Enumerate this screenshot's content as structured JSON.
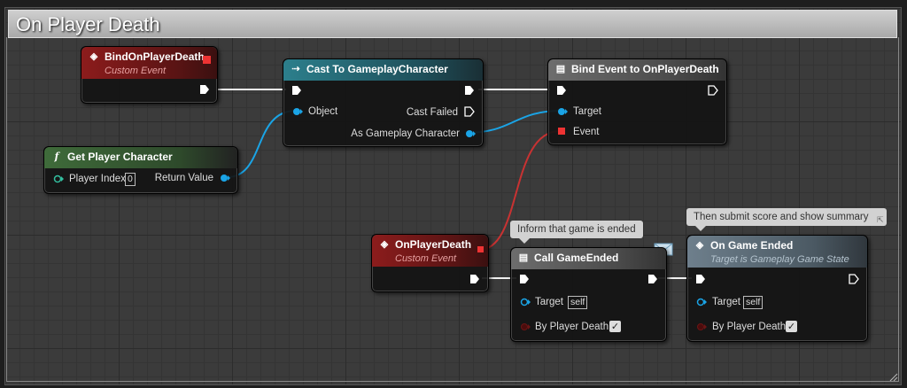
{
  "comment": {
    "title": "On Player Death"
  },
  "nodes": {
    "bind_on_player_death": {
      "title": "BindOnPlayerDeath",
      "subtitle": "Custom Event"
    },
    "cast_to_gameplay_character": {
      "title": "Cast To GameplayCharacter",
      "pins": {
        "object": "Object",
        "cast_failed": "Cast Failed",
        "as_gameplay_character": "As Gameplay Character"
      }
    },
    "bind_event": {
      "title": "Bind Event to OnPlayerDeath",
      "pins": {
        "target": "Target",
        "event": "Event"
      }
    },
    "get_player_character": {
      "title": "Get Player Character",
      "pins": {
        "player_index": "Player Index",
        "player_index_value": "0",
        "return_value": "Return Value"
      }
    },
    "on_player_death": {
      "title": "OnPlayerDeath",
      "subtitle": "Custom Event"
    },
    "call_game_ended": {
      "title": "Call GameEnded",
      "comment": "Inform that game is ended",
      "pins": {
        "target": "Target",
        "target_value": "self",
        "by_player_death": "By Player Death"
      }
    },
    "on_game_ended": {
      "title": "On Game Ended",
      "subtitle": "Target is Gameplay Game State",
      "comment": "Then submit score and show summary",
      "pins": {
        "target": "Target",
        "target_value": "self",
        "by_player_death": "By Player Death"
      }
    }
  },
  "colors": {
    "exec_wire": "#ffffff",
    "object_wire": "#1aa4e6",
    "delegate_wire": "#e23c3c",
    "event_header": "#8c1c1c",
    "cast_header": "#2c7f8c",
    "function_header": "#3f6b3a"
  }
}
